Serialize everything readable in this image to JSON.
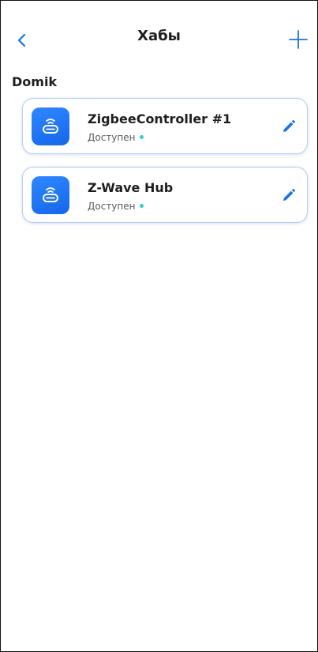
{
  "header": {
    "title": "Хабы",
    "back_icon": "chevron-left-icon",
    "add_icon": "plus-icon"
  },
  "group": {
    "label": "Domik"
  },
  "hubs": [
    {
      "name": "ZigbeeController #1",
      "status": "Доступен",
      "icon": "hub-router-icon",
      "edit_icon": "pencil-icon"
    },
    {
      "name": "Z-Wave Hub",
      "status": "Доступен",
      "icon": "hub-router-icon",
      "edit_icon": "pencil-icon"
    }
  ],
  "colors": {
    "accent": "#1a73e8",
    "tile_blue": "#1f78f2",
    "status_online": "#2ed3c6",
    "card_border": "#b6cdf2"
  }
}
